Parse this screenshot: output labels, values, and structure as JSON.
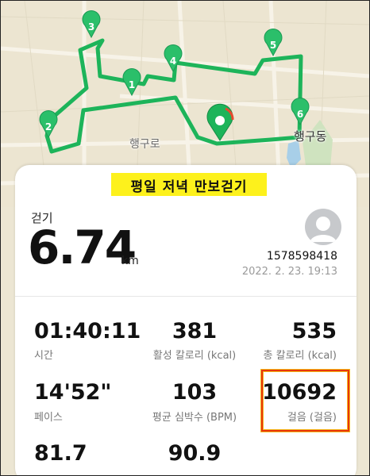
{
  "map": {
    "road_label": "행구로",
    "area_label": "행구동",
    "waypoints": [
      "1",
      "2",
      "3",
      "4",
      "5",
      "6"
    ],
    "route_color": "#1db45a"
  },
  "workout": {
    "title": "평일 저녁 만보걷기",
    "type_label": "걷기",
    "distance": "6.74",
    "distance_unit": "km",
    "user_id": "1578598418",
    "date": "2022. 2. 23. 19:13"
  },
  "stats": {
    "duration": {
      "value": "01:40:11",
      "label": "시간"
    },
    "active_calories": {
      "value": "381",
      "label": "활성 칼로리 (kcal)"
    },
    "total_calories": {
      "value": "535",
      "label": "총 칼로리 (kcal)"
    },
    "pace": {
      "value": "14'52\"",
      "label": "페이스"
    },
    "avg_heart_rate": {
      "value": "103",
      "label": "평균 심박수 (BPM)"
    },
    "steps": {
      "value": "10692",
      "label": "걸음 (걸음)"
    },
    "row3_left": {
      "value": "81.7"
    },
    "row3_center": {
      "value": "90.9"
    }
  },
  "colors": {
    "accent_green": "#1db45a",
    "title_highlight": "#fdf11c",
    "selection_border": "#e8350c"
  }
}
